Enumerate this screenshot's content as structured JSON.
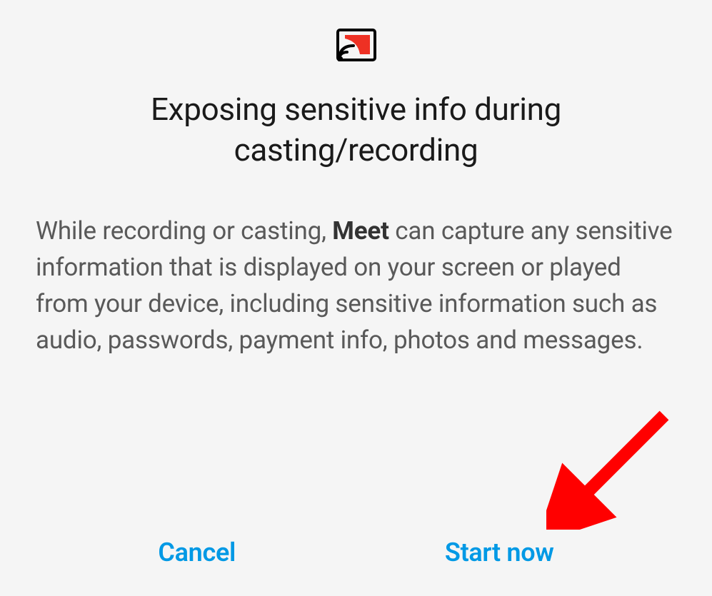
{
  "dialog": {
    "title": "Exposing sensitive info during casting/recording",
    "body_prefix": "While recording or casting, ",
    "body_bold": "Meet",
    "body_suffix": " can capture any sensitive information that is displayed on your screen or played from your device, including sensitive information such as audio, passwords, payment info, photos and messages.",
    "cancel_label": "Cancel",
    "start_label": "Start now"
  },
  "icons": {
    "cast": "cast-icon"
  },
  "colors": {
    "accent": "#0099e5",
    "icon_fill": "#ee3124",
    "arrow": "#ff0000"
  }
}
